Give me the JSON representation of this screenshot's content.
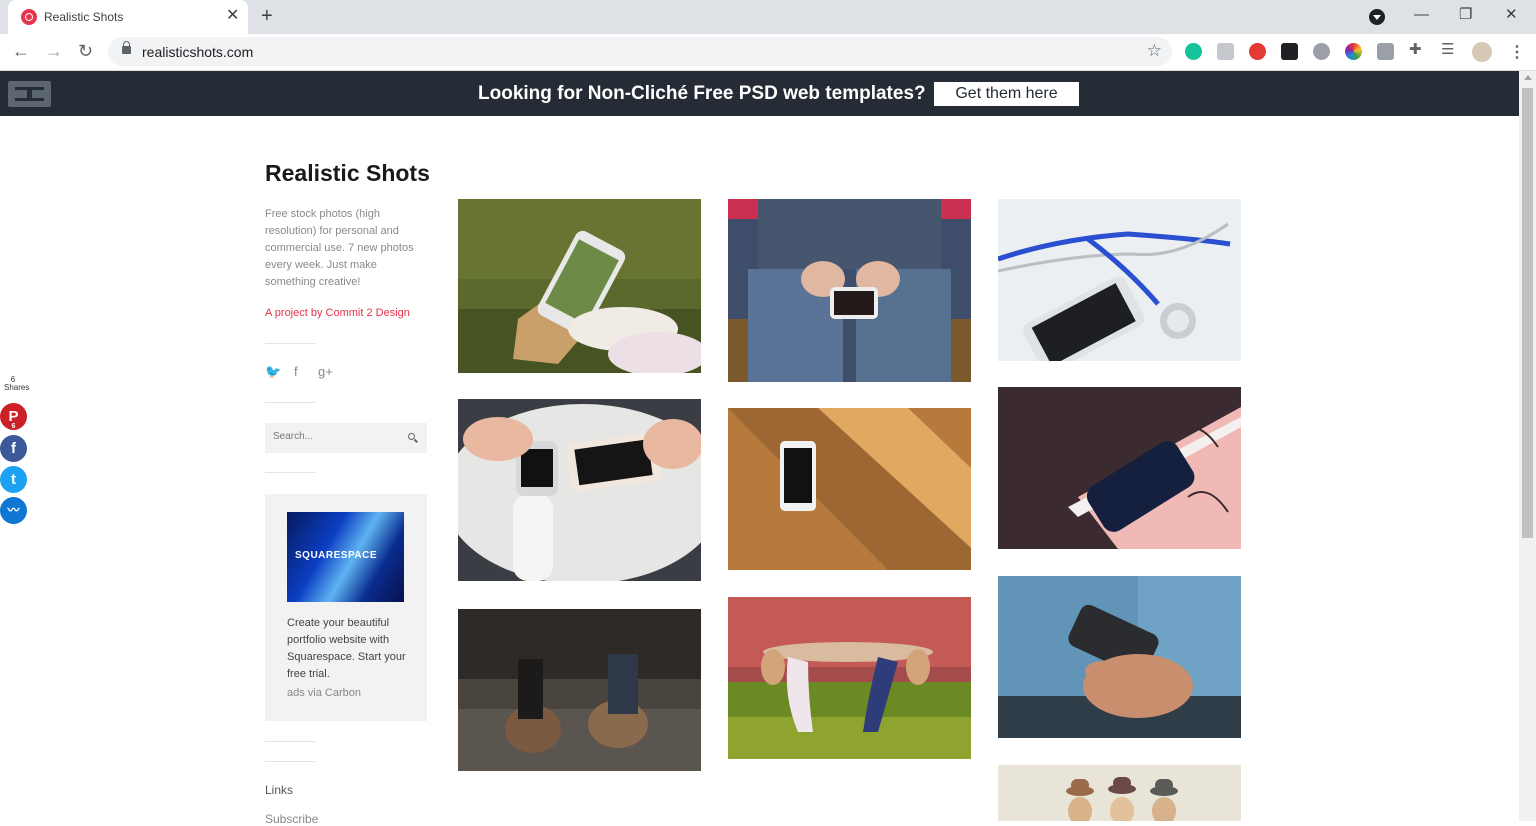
{
  "browser": {
    "tab_title": "Realistic Shots",
    "tab_close": "✕",
    "new_tab": "+",
    "url": "realisticshots.com",
    "star_icon": "☆",
    "window_minimize": "—",
    "window_restore": "❐",
    "window_close": "✕",
    "back": "←",
    "forward": "→",
    "reload": "↻",
    "menu": "⋮"
  },
  "banner": {
    "text": "Looking for Non-Cliché Free PSD web templates?",
    "cta": "Get them here"
  },
  "share": {
    "count": "6",
    "label": "Shares",
    "pinterest_count": "6",
    "pinterest_glyph": "P",
    "facebook_glyph": "f",
    "twitter_glyph": "t",
    "other_glyph": "〰",
    "colors": {
      "pinterest": "#cb2027",
      "facebook": "#3b5998",
      "twitter": "#1da1f2",
      "other": "#0f76d1"
    }
  },
  "sidebar": {
    "title": "Realistic Shots",
    "description": "Free stock photos (high resolution) for personal and commercial use. 7 new photos every week. Just make something creative!",
    "project_link": "A project by Commit 2 Design",
    "social": {
      "twitter": "🐦",
      "facebook": "f",
      "googleplus": "g+"
    },
    "search_placeholder": "Search...",
    "ad": {
      "logo": "SQUARESPACE",
      "text": "Create your beautiful portfolio website with Squarespace. Start your free trial.",
      "via": "ads via Carbon"
    },
    "links_label": "Links",
    "subscribe_label": "Subscribe"
  },
  "photos": [
    {
      "name": "photo-phone-on-grass",
      "alt": "Hand holding phone over autumn leaf on grass"
    },
    {
      "name": "photo-phone-in-lap",
      "alt": "Person in jeans holding phone"
    },
    {
      "name": "photo-stethoscope-phone",
      "alt": "Stethoscope and phone on white"
    },
    {
      "name": "photo-smartwatch-phone",
      "alt": "Hands holding smartwatch and phone"
    },
    {
      "name": "photo-phone-on-wood",
      "alt": "Phone on wooden table in sunlight"
    },
    {
      "name": "photo-phone-on-notebook",
      "alt": "Dark phone on pink notebook"
    },
    {
      "name": "photo-girls-on-car",
      "alt": "Two girls lying on car hood"
    },
    {
      "name": "photo-girls-in-field",
      "alt": "Two girls bending back in field"
    },
    {
      "name": "photo-hand-holding-phone",
      "alt": "Hand holding phone blue background"
    },
    {
      "name": "photo-hats-beach",
      "alt": "People with hats at beach"
    }
  ],
  "colors": {
    "accent": "#e5334a",
    "banner_bg": "#252c36"
  }
}
